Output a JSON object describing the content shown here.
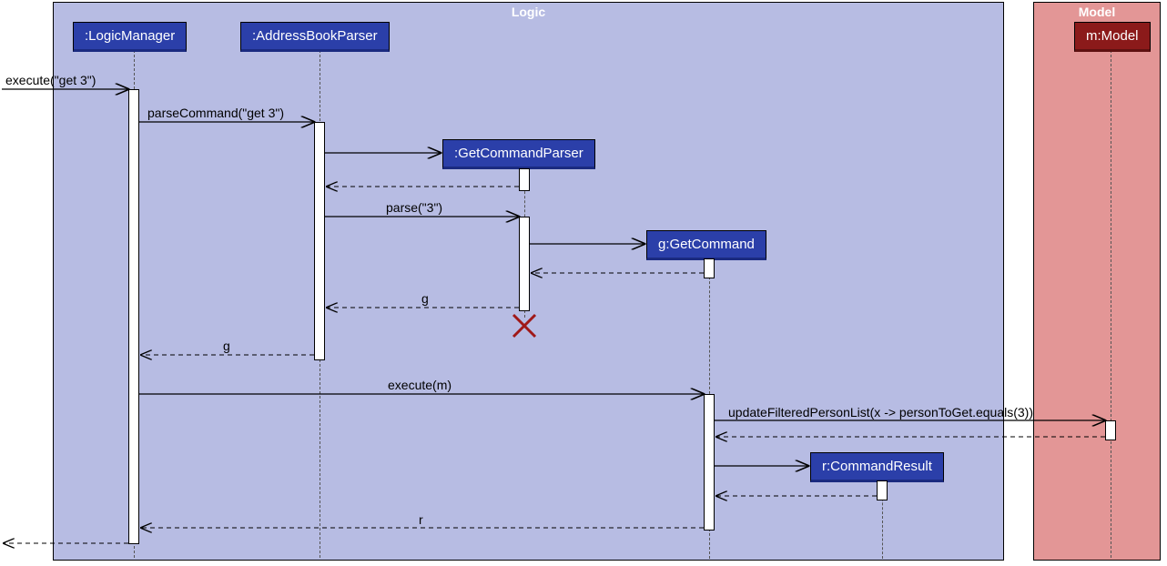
{
  "frames": {
    "logic": {
      "title": "Logic"
    },
    "model": {
      "title": "Model"
    }
  },
  "lifelines": {
    "logicManager": ":LogicManager",
    "addressBookParser": ":AddressBookParser",
    "getCommandParser": ":GetCommandParser",
    "getCommand": "g:GetCommand",
    "commandResult": "r:CommandResult",
    "model": "m:Model"
  },
  "messages": {
    "execute": "execute(\"get 3\")",
    "parseCommand": "parseCommand(\"get 3\")",
    "parse": "parse(\"3\")",
    "return_g1": "g",
    "return_g2": "g",
    "executeM": "execute(m)",
    "updateFiltered": "updateFilteredPersonList(x -> personToGet.equals(3))",
    "return_r": "r"
  }
}
